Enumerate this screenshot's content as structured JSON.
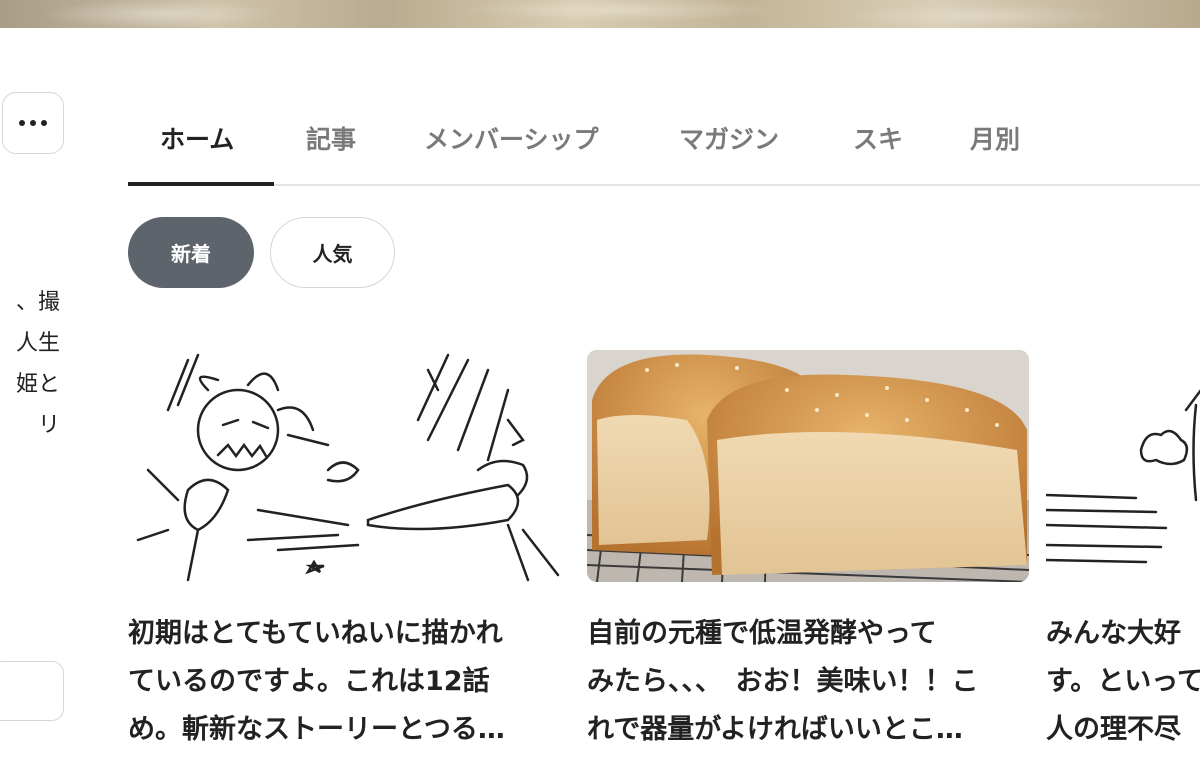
{
  "sidebar": {
    "more_icon": "more-horizontal-icon",
    "bio_lines": [
      "、撮",
      "人生",
      "姫と",
      "リ"
    ]
  },
  "tabs": [
    {
      "label": "ホーム",
      "active": true
    },
    {
      "label": "記事",
      "active": false
    },
    {
      "label": "メンバーシップ",
      "active": false
    },
    {
      "label": "マガジン",
      "active": false
    },
    {
      "label": "スキ",
      "active": false
    },
    {
      "label": "月別",
      "active": false
    }
  ],
  "filters": {
    "new_label": "新着",
    "popular_label": "人気"
  },
  "articles": [
    {
      "image": "manga-illustration",
      "title_lines": [
        "初期はとてもていねいに描かれ",
        "ているのですよ。これは12話",
        "め。斬新なストーリーとつる…"
      ]
    },
    {
      "image": "bread-loaf-photo",
      "title_lines": [
        "自前の元種で低温発酵やって",
        "みたら、、、　おお！美味い！！こ",
        "れで器量がよければいいとこ…"
      ]
    },
    {
      "image": "manga-illustration",
      "title_lines": [
        "みんな大好",
        "す。といって",
        "人の理不尽"
      ]
    }
  ],
  "colors": {
    "active_chip_bg": "#5d646b",
    "tab_inactive": "#7a7a7a",
    "text": "#222222"
  }
}
